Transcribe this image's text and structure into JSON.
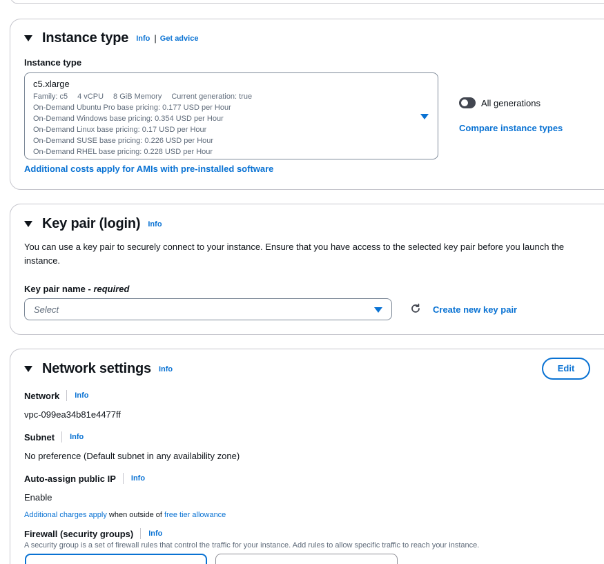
{
  "instance_type": {
    "title": "Instance type",
    "info": "Info",
    "separator": "|",
    "get_advice": "Get advice",
    "field_label": "Instance type",
    "selected": "c5.xlarge",
    "meta": {
      "family": "Family: c5",
      "vcpu": "4 vCPU",
      "memory": "8 GiB Memory",
      "generation": "Current generation: true"
    },
    "pricing": [
      "On-Demand Ubuntu Pro base pricing: 0.177 USD per Hour",
      "On-Demand Windows base pricing: 0.354 USD per Hour",
      "On-Demand Linux base pricing: 0.17 USD per Hour",
      "On-Demand SUSE base pricing: 0.226 USD per Hour",
      "On-Demand RHEL base pricing: 0.228 USD per Hour"
    ],
    "all_generations": "All generations",
    "all_generations_on": false,
    "compare": "Compare instance types",
    "additional_costs": "Additional costs apply for AMIs with pre-installed software"
  },
  "key_pair": {
    "title": "Key pair (login)",
    "info": "Info",
    "description": "You can use a key pair to securely connect to your instance. Ensure that you have access to the selected key pair before you launch the instance.",
    "field_label": "Key pair name - ",
    "required": "required",
    "placeholder": "Select",
    "create": "Create new key pair"
  },
  "network": {
    "title": "Network settings",
    "info": "Info",
    "edit": "Edit",
    "network_label": "Network",
    "network_value": "vpc-099ea34b81e4477ff",
    "subnet_label": "Subnet",
    "subnet_value": "No preference (Default subnet in any availability zone)",
    "public_ip_label": "Auto-assign public IP",
    "public_ip_value": "Enable",
    "charges_link": "Additional charges apply",
    "charges_mid": " when outside of ",
    "free_tier_link": "free tier allowance",
    "firewall_label": "Firewall (security groups)",
    "firewall_desc": "A security group is a set of firewall rules that control the traffic for your instance. Add rules to allow specific traffic to reach your instance."
  },
  "colors": {
    "link": "#0972d3",
    "text": "#0f141a",
    "muted": "#5f6b7a",
    "border": "#c6c6cd"
  }
}
